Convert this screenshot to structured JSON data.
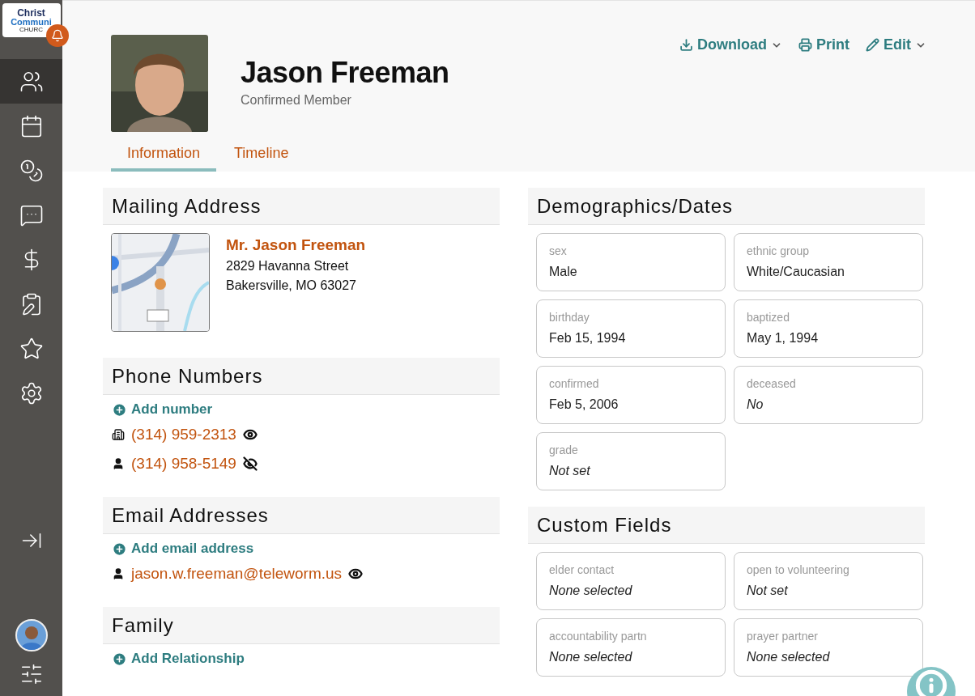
{
  "logo": {
    "line_1": "Christ",
    "line_2": "Communi",
    "line_3": "CHURC"
  },
  "sidebar": {
    "items": [
      {
        "selected": true
      },
      {
        "selected": false
      },
      {
        "selected": false
      },
      {
        "selected": false
      },
      {
        "selected": false
      },
      {
        "selected": false
      },
      {
        "selected": false
      },
      {
        "selected": false
      }
    ]
  },
  "header": {
    "name": "Jason Freeman",
    "status": "Confirmed Member",
    "actions": [
      {
        "label": "Download",
        "menu": true
      },
      {
        "label": "Print",
        "menu": false
      },
      {
        "label": "Edit",
        "menu": true
      }
    ],
    "tabs": [
      {
        "label": "Information",
        "selected": true
      },
      {
        "label": "Timeline",
        "selected": false
      }
    ]
  },
  "mailing_address": {
    "title": "Mailing Address",
    "name": "Mr. Jason Freeman",
    "line_1": "2829 Havanna Street",
    "line_2": "Bakersville, MO 63027"
  },
  "phone_numbers": {
    "title": "Phone Numbers",
    "add": "Add number",
    "items": [
      {
        "kind": "work",
        "value": "(314) 959-2313",
        "visible": true
      },
      {
        "kind": "personal",
        "value": "(314) 958-5149",
        "visible": false
      }
    ]
  },
  "email_addresses": {
    "title": "Email Addresses",
    "add": "Add email address",
    "items": [
      {
        "kind": "personal",
        "value": "jason.w.freeman@teleworm.us",
        "visible": true
      }
    ]
  },
  "family": {
    "title": "Family",
    "add": "Add Relationship"
  },
  "demographics": {
    "title": "Demographics/Dates",
    "fields": [
      {
        "label": "sex",
        "value": "Male",
        "unset": false
      },
      {
        "label": "ethnic group",
        "value": "White/Caucasian",
        "unset": false
      },
      {
        "label": "birthday",
        "value": "Feb 15, 1994",
        "unset": false
      },
      {
        "label": "baptized",
        "value": "May 1, 1994",
        "unset": false
      },
      {
        "label": "confirmed",
        "value": "Feb 5, 2006",
        "unset": false
      },
      {
        "label": "deceased",
        "value": "No",
        "unset": true
      },
      {
        "label": "grade",
        "value": "Not set",
        "unset": true
      }
    ]
  },
  "custom_fields": {
    "title": "Custom Fields",
    "fields": [
      {
        "label": "elder contact",
        "value": "None selected",
        "unset": true
      },
      {
        "label": "open to volunteering",
        "value": "Not set",
        "unset": true
      },
      {
        "label": "accountability partn",
        "value": "None selected",
        "unset": true
      },
      {
        "label": "prayer partner",
        "value": "None selected",
        "unset": true
      }
    ]
  }
}
